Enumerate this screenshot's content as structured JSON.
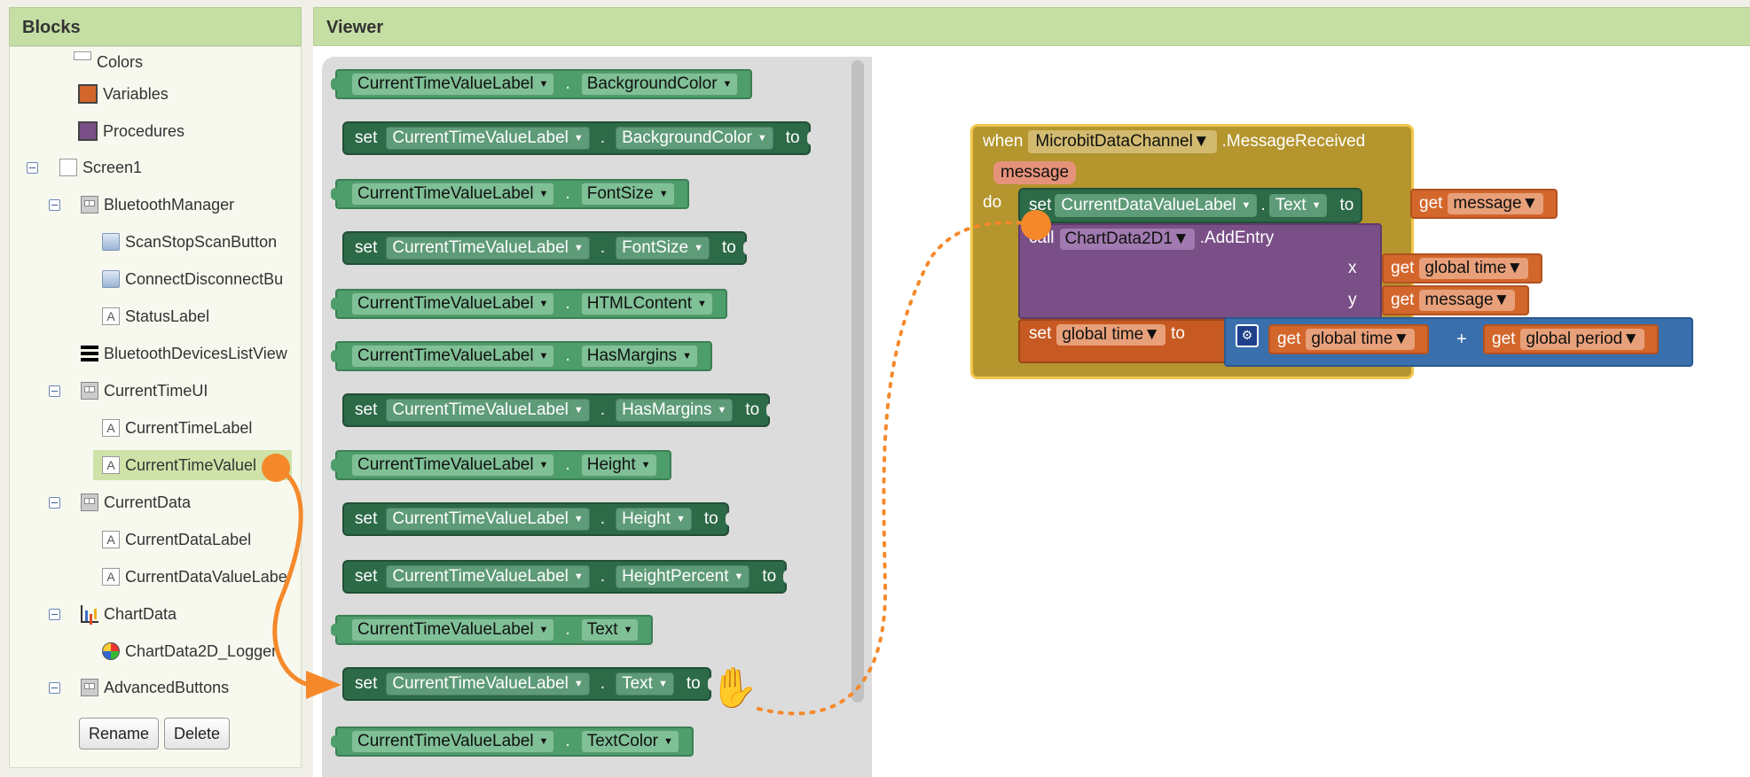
{
  "blocks_panel": {
    "title": "Blocks"
  },
  "viewer_panel": {
    "title": "Viewer"
  },
  "tree": [
    {
      "label": "Colors"
    },
    {
      "label": "Variables"
    },
    {
      "label": "Procedures"
    },
    {
      "label": "Screen1"
    },
    {
      "label": "BluetoothManager"
    },
    {
      "label": "ScanStopScanButton"
    },
    {
      "label": "ConnectDisconnectBu"
    },
    {
      "label": "StatusLabel"
    },
    {
      "label": "BluetoothDevicesListView"
    },
    {
      "label": "CurrentTimeUI"
    },
    {
      "label": "CurrentTimeLabel"
    },
    {
      "label": "CurrentTimeValuel"
    },
    {
      "label": "CurrentData"
    },
    {
      "label": "CurrentDataLabel"
    },
    {
      "label": "CurrentDataValueLabe"
    },
    {
      "label": "ChartData"
    },
    {
      "label": "ChartData2D_Logger"
    },
    {
      "label": "AdvancedButtons"
    }
  ],
  "tree_buttons": {
    "rename": "Rename",
    "delete": "Delete"
  },
  "flyout": {
    "component": "CurrentTimeValueLabel",
    "set_kw": "set",
    "to_kw": "to",
    "dot": ".",
    "blocks": [
      {
        "kind": "get",
        "prop": "BackgroundColor"
      },
      {
        "kind": "set",
        "prop": "BackgroundColor"
      },
      {
        "kind": "get",
        "prop": "FontSize"
      },
      {
        "kind": "set",
        "prop": "FontSize"
      },
      {
        "kind": "get",
        "prop": "HTMLContent"
      },
      {
        "kind": "get",
        "prop": "HasMargins"
      },
      {
        "kind": "set",
        "prop": "HasMargins"
      },
      {
        "kind": "get",
        "prop": "Height"
      },
      {
        "kind": "set",
        "prop": "Height"
      },
      {
        "kind": "set",
        "prop": "HeightPercent"
      },
      {
        "kind": "get",
        "prop": "Text"
      },
      {
        "kind": "set",
        "prop": "Text"
      },
      {
        "kind": "get",
        "prop": "TextColor"
      }
    ]
  },
  "event_block": {
    "when": "when",
    "component": "MicrobitDataChannel",
    "event": ".MessageReceived",
    "param": "message",
    "do": "do",
    "set_text": {
      "set": "set",
      "component": "CurrentDataValueLabel",
      "dot": ".",
      "prop": "Text",
      "to": "to",
      "get": "get",
      "var": "message"
    },
    "call_add": {
      "call": "call",
      "component": "ChartData2D1",
      "method": ".AddEntry",
      "x": "x",
      "y": "y",
      "get": "get",
      "x_var": "global time",
      "y_var": "message"
    },
    "set_global": {
      "set": "set",
      "var": "global time",
      "to": "to",
      "get": "get",
      "lhs": "global time",
      "op": "+",
      "rhs": "global period"
    }
  },
  "colors": {
    "header_green": "#c5dea3",
    "component_block": "#4d9e6a",
    "setter_block": "#2d6a48",
    "event_block": "#b4952e",
    "procedure_block": "#7a4f87",
    "variable_block": "#d3662b",
    "math_block": "#3a6fae",
    "drag_orange": "#f5892a"
  }
}
